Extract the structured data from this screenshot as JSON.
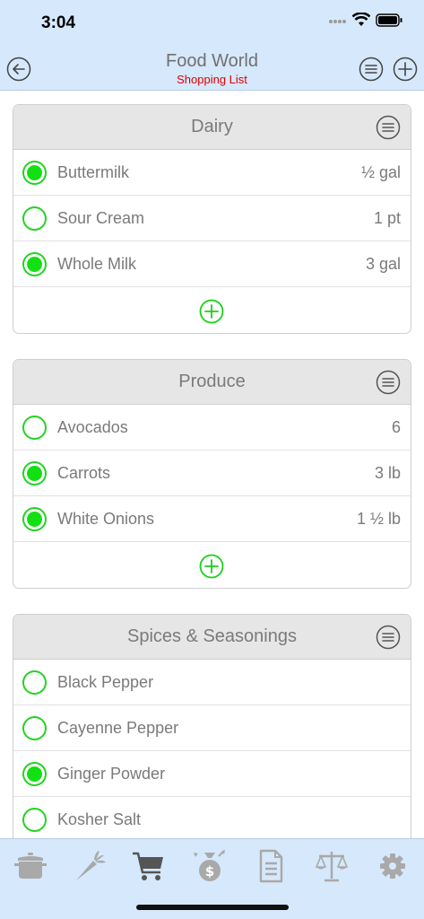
{
  "status_bar": {
    "time": "3:04"
  },
  "header": {
    "title": "Food World",
    "subtitle": "Shopping List",
    "back_icon": "circle-back-arrow-icon",
    "menu_icon": "circle-hamburger-icon",
    "add_icon": "circle-plus-icon"
  },
  "colors": {
    "bar_bg": "#d6e8fb",
    "check_green": "#13e013",
    "subtitle_red": "#e00000",
    "text_gray": "#7a7a7a"
  },
  "sections": [
    {
      "title": "Dairy",
      "items": [
        {
          "name": "Buttermilk",
          "qty": "½ gal",
          "checked": true
        },
        {
          "name": "Sour Cream",
          "qty": "1 pt",
          "checked": false
        },
        {
          "name": "Whole Milk",
          "qty": "3 gal",
          "checked": true
        }
      ]
    },
    {
      "title": "Produce",
      "items": [
        {
          "name": "Avocados",
          "qty": "6",
          "checked": false
        },
        {
          "name": "Carrots",
          "qty": "3 lb",
          "checked": true
        },
        {
          "name": "White Onions",
          "qty": "1 ½ lb",
          "checked": true
        }
      ]
    },
    {
      "title": "Spices & Seasonings",
      "items": [
        {
          "name": "Black Pepper",
          "qty": "",
          "checked": false
        },
        {
          "name": "Cayenne Pepper",
          "qty": "",
          "checked": false
        },
        {
          "name": "Ginger Powder",
          "qty": "",
          "checked": true
        },
        {
          "name": "Kosher Salt",
          "qty": "",
          "checked": false
        }
      ]
    }
  ],
  "tabbar": {
    "tabs": [
      {
        "icon": "cooking-pot-icon",
        "active": false
      },
      {
        "icon": "carrot-icon",
        "active": false
      },
      {
        "icon": "shopping-cart-icon",
        "active": true
      },
      {
        "icon": "money-bag-icon",
        "active": false
      },
      {
        "icon": "document-icon",
        "active": false
      },
      {
        "icon": "balance-scale-icon",
        "active": false
      },
      {
        "icon": "gear-icon",
        "active": false
      }
    ]
  }
}
